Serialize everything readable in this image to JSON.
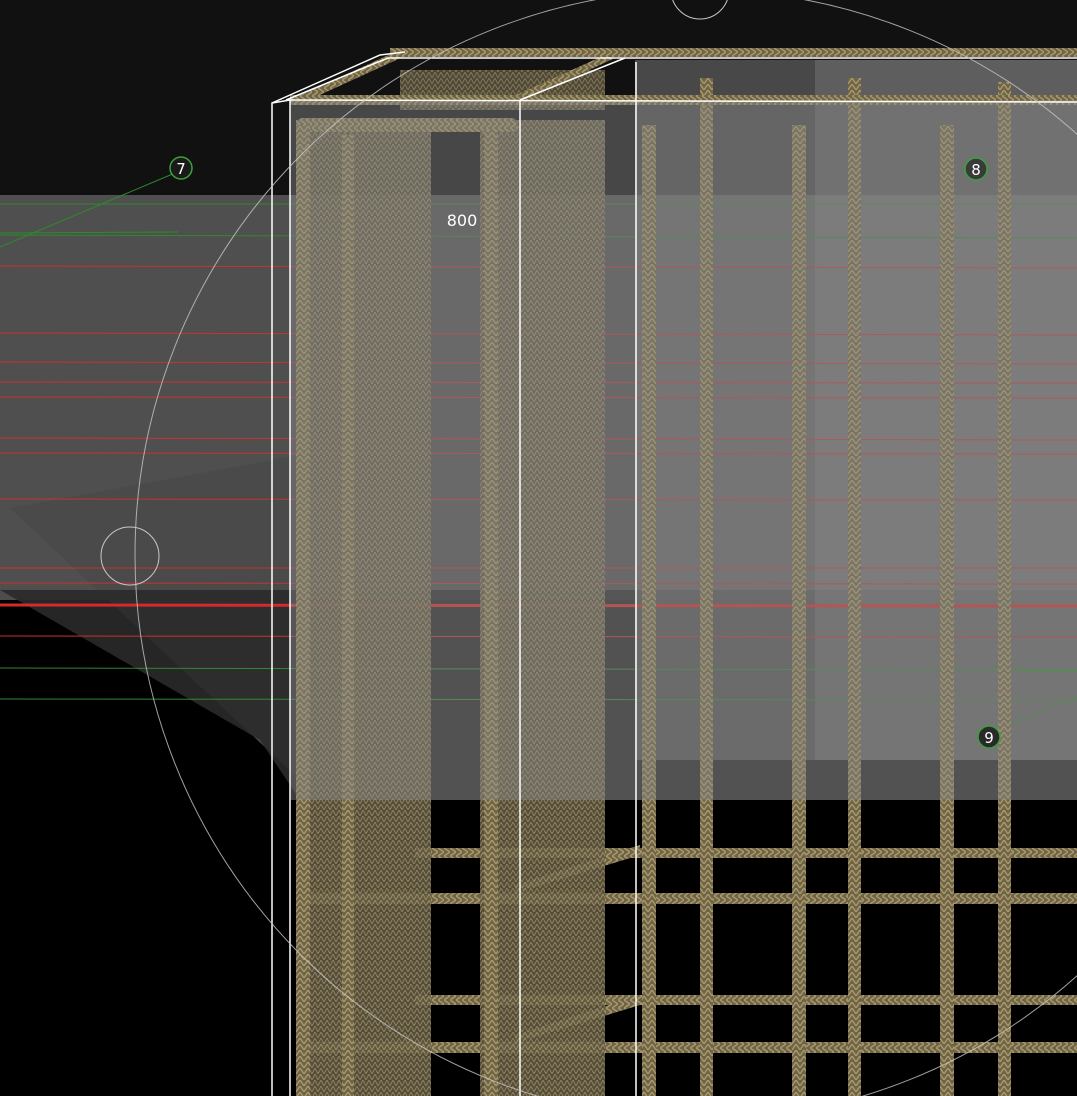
{
  "viewport": {
    "name": "3d-model-viewport"
  },
  "grid_markers": [
    {
      "id": "7",
      "label": "7"
    },
    {
      "id": "8",
      "label": "8"
    },
    {
      "id": "9",
      "label": "9"
    }
  ],
  "dimension": {
    "label": "800"
  },
  "colors": {
    "background_top": "#111111",
    "background_bottom": "#000000",
    "concrete_overlay": "#8a8a8a",
    "rebar": "#7a6e4c",
    "rebar_highlight": "#a89a70",
    "grid_line_red": "#c83232",
    "grid_line_green": "#2e8a2e",
    "marker_stroke": "#3aa23a",
    "selection_outline": "#ffffff",
    "orbit_circle": "#c8c8c8"
  }
}
